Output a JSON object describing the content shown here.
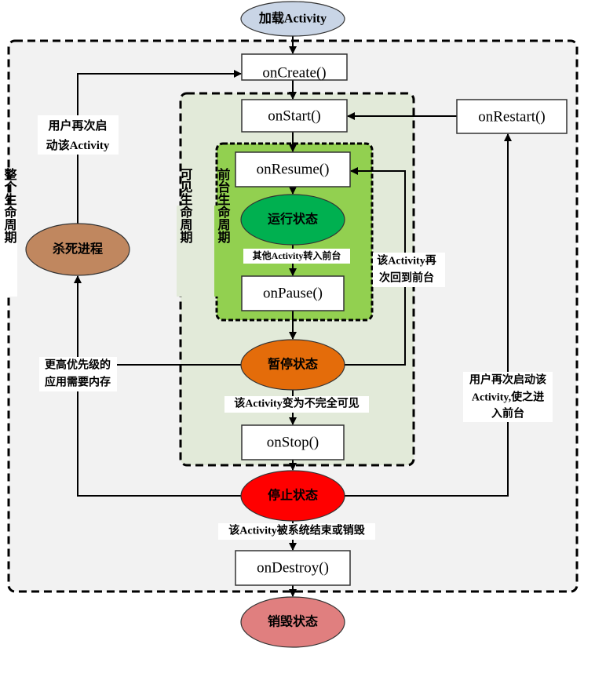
{
  "nodes": {
    "load": "加载Activity",
    "on_create": "onCreate()",
    "on_start": "onStart()",
    "on_restart": "onRestart()",
    "on_resume": "onResume()",
    "running": "运行状态",
    "on_pause": "onPause()",
    "paused": "暂停状态",
    "on_stop": "onStop()",
    "stopped": "停止状态",
    "on_destroy": "onDestroy()",
    "destroyed": "销毁状态",
    "kill_process": "杀死进程"
  },
  "edge_labels": {
    "other_activity_front": "其他Activity转入前台",
    "partially_visible": "该Activity变为不完全可见",
    "destroyed_by_system": "该Activity被系统结束或销毁",
    "user_restart_line1": "用户再次启",
    "user_restart_line2": "动该Activity",
    "memory_line1": "更高优先级的",
    "memory_line2": "应用需要内存",
    "back_front_line1": "该Activity再",
    "back_front_line2": "次回到前台",
    "restart_front_line1": "用户再次启动该",
    "restart_front_line2": "Activity,使之进",
    "restart_front_line3": "入前台"
  },
  "regions": {
    "entire_lifetime": "整个生命周期",
    "visible_lifetime": "可见生命周期",
    "foreground_lifetime": "前台生命周期"
  },
  "colors": {
    "load": "#c9d5e6",
    "running": "#00b050",
    "paused": "#e46c0a",
    "stopped": "#ff0000",
    "destroyed": "#e07f7f",
    "kill_process": "#c0875f",
    "entire_region": "#f2f2f2",
    "visible_region": "#e2ead9",
    "foreground_region": "#92d050"
  }
}
